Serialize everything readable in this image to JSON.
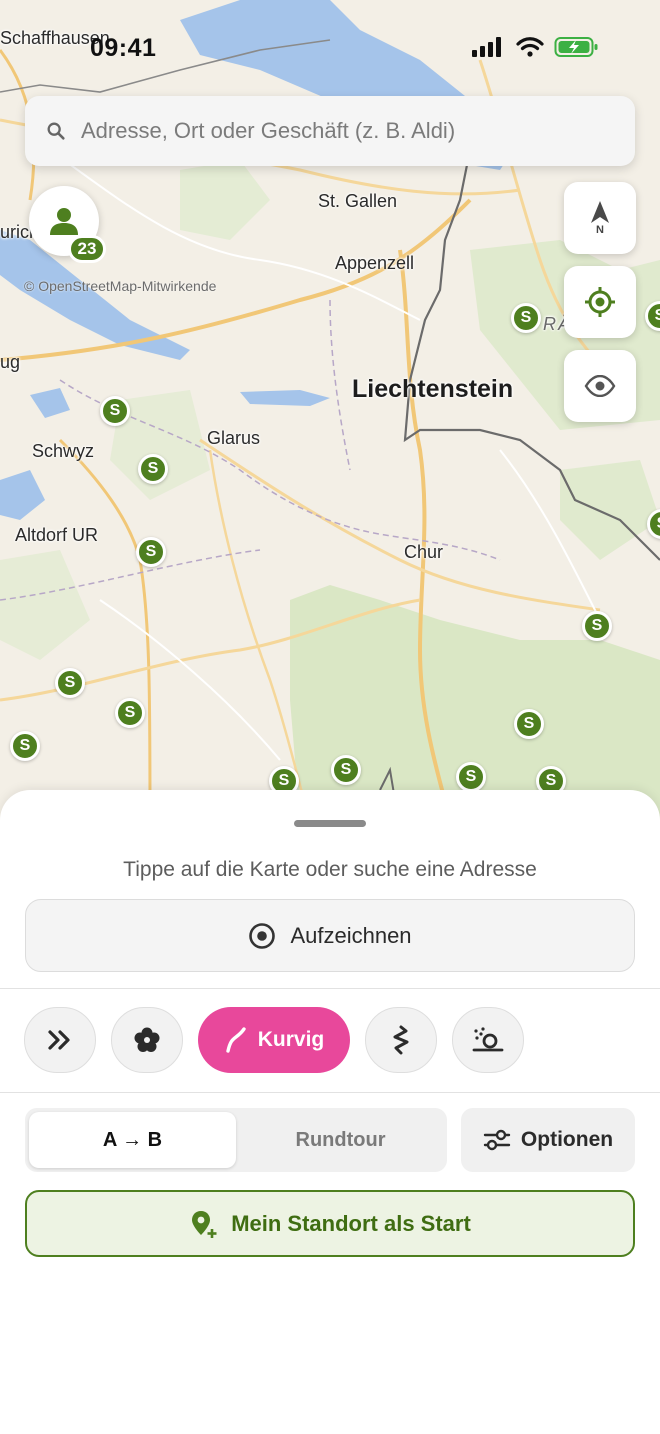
{
  "status": {
    "time": "09:41"
  },
  "search": {
    "placeholder": "Adresse, Ort oder Geschäft (z. B. Aldi)"
  },
  "map": {
    "attribution": "© OpenStreetMap-Mitwirkende",
    "places": {
      "schaffhausen": "Schaffhausen",
      "st_gallen": "St. Gallen",
      "appenzell": "Appenzell",
      "liechtenstein": "Liechtenstein",
      "zurich_partial": "urich",
      "zug_partial": "ug",
      "schwyz": "Schwyz",
      "glarus": "Glarus",
      "altdorf": "Altdorf UR",
      "chur": "Chur",
      "raetikon_partial": "RÄ  R"
    },
    "poi_symbol": "S",
    "avatar_badge": "23",
    "north_label": "N"
  },
  "sheet": {
    "hint": "Tippe auf die Karte oder suche eine Adresse",
    "record_label": "Aufzeichnen",
    "modes": {
      "active_label": "Kurvig"
    },
    "segment": {
      "ab": "A → B",
      "round": "Rundtour"
    },
    "options_label": "Optionen",
    "start_label": "Mein Standort als Start"
  },
  "colors": {
    "accent_green": "#4e7f1f",
    "accent_pink": "#e8489b"
  }
}
